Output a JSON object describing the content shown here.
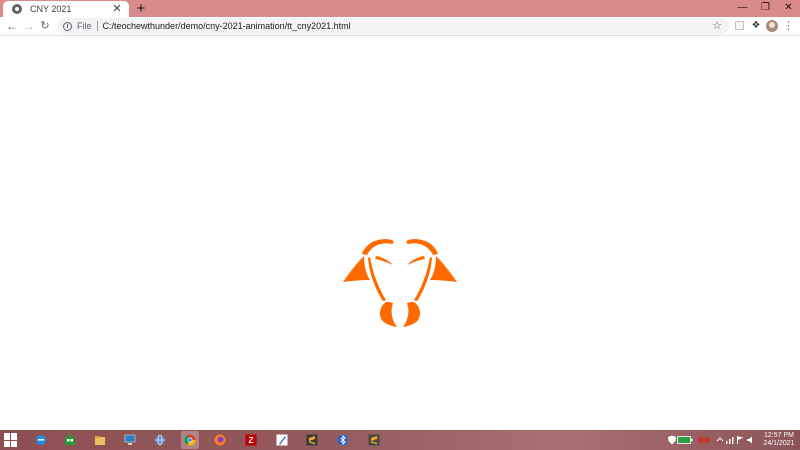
{
  "browser": {
    "tab": {
      "title": "CNY 2021",
      "close_glyph": "✕"
    },
    "new_tab_glyph": "+",
    "window_controls": {
      "minimize": "—",
      "maximize": "❐",
      "close": "✕"
    },
    "address": {
      "scheme_label": "File",
      "url": "C:/teochewthunder/demo/cny-2021-animation/tt_cny2021.html"
    },
    "icons": {
      "back": "back-arrow-icon",
      "forward": "forward-arrow-icon",
      "reload": "reload-icon",
      "info": "info-icon",
      "bookmark": "star-icon",
      "extensions": "puzzle-icon",
      "profile": "avatar",
      "menu": "more-menu-icon"
    }
  },
  "page": {
    "logo": {
      "name": "ox-head-logo",
      "color": "#ff6a00"
    }
  },
  "taskbar": {
    "apps": [
      "start-menu",
      "internet-explorer",
      "windows-store",
      "file-explorer",
      "remote-desktop",
      "network-globe",
      "chrome",
      "firefox",
      "filezilla",
      "notepad-pen",
      "sublime-text",
      "bluetooth",
      "sublime-text-2"
    ],
    "active_app": "chrome",
    "clock": {
      "time": "12:57 PM",
      "date": "24/1/2021"
    }
  },
  "colors": {
    "titlebar": "#d98a8a",
    "accent": "#ff6a00",
    "taskbar": "#8e4f52"
  }
}
